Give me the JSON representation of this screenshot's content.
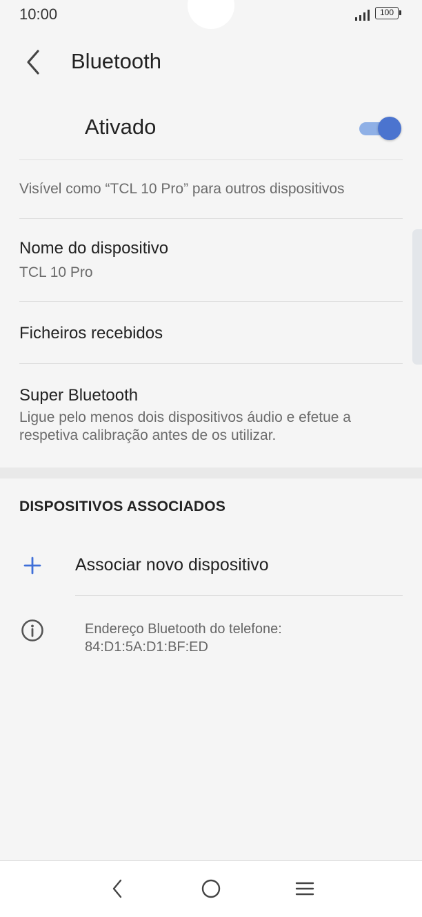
{
  "status_bar": {
    "time": "10:00",
    "battery": "100",
    "icons": [
      "signal-icon",
      "battery-icon"
    ]
  },
  "header": {
    "title": "Bluetooth",
    "back_icon": "chevron-left-icon"
  },
  "bluetooth_toggle": {
    "label": "Ativado",
    "on": true,
    "colors": {
      "track": "#8fb0e6",
      "knob": "#4b74cf"
    }
  },
  "visibility_text": "Visível como “TCL 10 Pro” para outros dispositivos",
  "settings": {
    "device_name": {
      "title": "Nome do dispositivo",
      "value": "TCL 10 Pro"
    },
    "received_files": {
      "title": "Ficheiros recebidos"
    },
    "super_bluetooth": {
      "title": "Super Bluetooth",
      "description_line1": "Ligue pelo menos dois dispositivos áudio e efetue a",
      "description_line2": "respetiva calibração antes de os utilizar."
    }
  },
  "paired_devices": {
    "section_title": "DISPOSITIVOS ASSOCIADOS",
    "add_label": "Associar novo dispositivo",
    "accent_color": "#3f6fd8"
  },
  "info": {
    "line1": "Endereço Bluetooth do telefone:",
    "line2": "84:D1:5A:D1:BF:ED",
    "icon": "info-icon"
  },
  "nav_bar": {
    "icons": [
      "back-icon",
      "home-icon",
      "menu-icon"
    ]
  }
}
